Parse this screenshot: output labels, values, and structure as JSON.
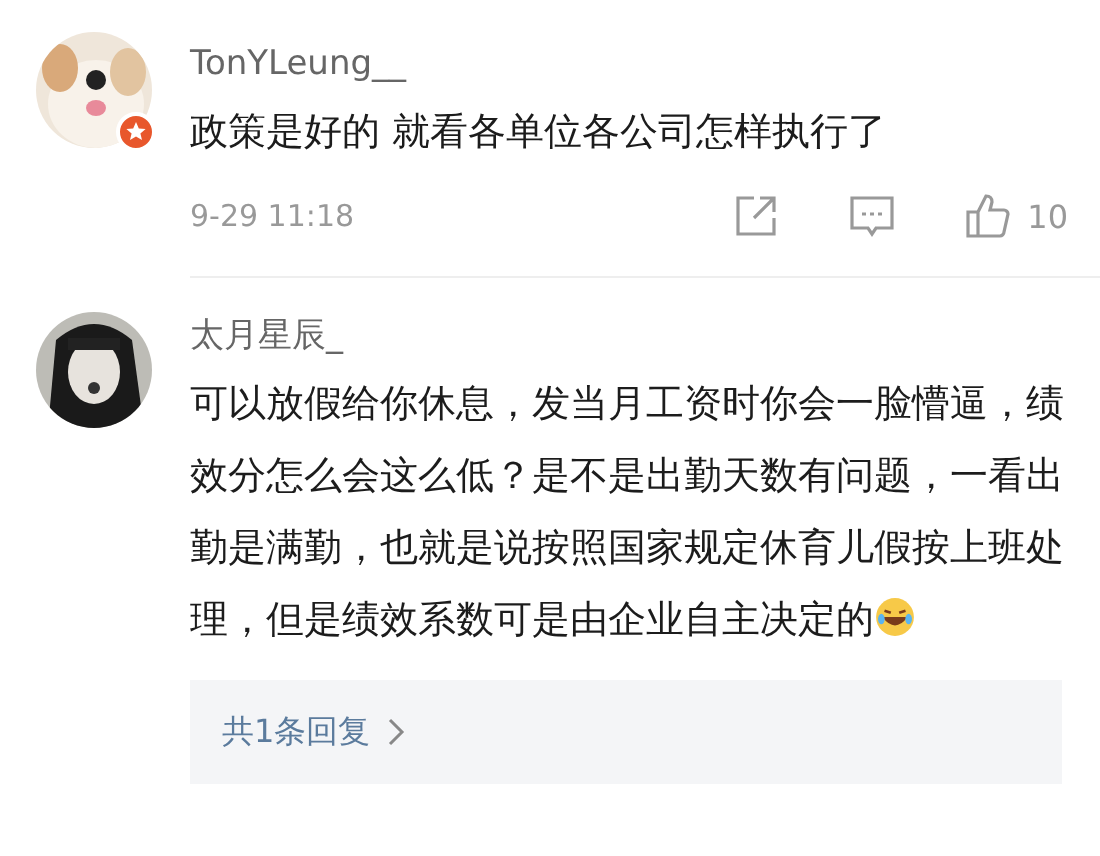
{
  "comments": [
    {
      "user": "TonYLeung__",
      "verified": true,
      "text": "政策是好的 就看各单位各公司怎样执行了",
      "emoji": false,
      "time": "9-29 11:18",
      "likes": "10"
    },
    {
      "user": "太月星辰_",
      "verified": false,
      "text": "可以放假给你休息，发当月工资时你会一脸懵逼，绩效分怎么会这么低？是不是出勤天数有问题，一看出勤是满勤，也就是说按照国家规定休育儿假按上班处理，但是绩效系数可是由企业自主决定的",
      "emoji": true,
      "replies": "共1条回复"
    }
  ]
}
